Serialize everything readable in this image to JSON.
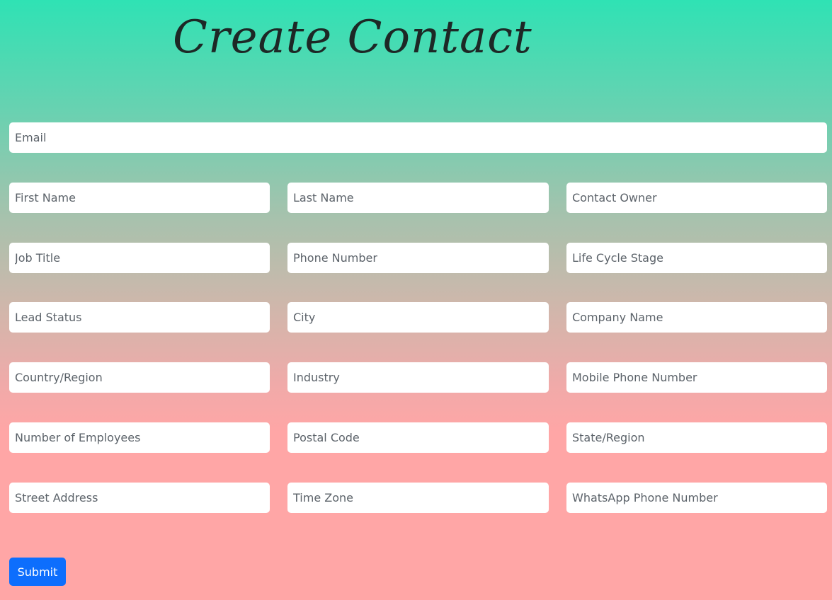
{
  "title": "Create Contact",
  "form": {
    "email": {
      "placeholder": "Email",
      "value": ""
    },
    "first_name": {
      "placeholder": "First Name",
      "value": ""
    },
    "last_name": {
      "placeholder": "Last Name",
      "value": ""
    },
    "contact_owner": {
      "placeholder": "Contact Owner",
      "value": ""
    },
    "job_title": {
      "placeholder": "Job Title",
      "value": ""
    },
    "phone_number": {
      "placeholder": "Phone Number",
      "value": ""
    },
    "life_cycle_stage": {
      "placeholder": "Life Cycle Stage",
      "value": ""
    },
    "lead_status": {
      "placeholder": "Lead Status",
      "value": ""
    },
    "city": {
      "placeholder": "City",
      "value": ""
    },
    "company_name": {
      "placeholder": "Company Name",
      "value": ""
    },
    "country_region": {
      "placeholder": "Country/Region",
      "value": ""
    },
    "industry": {
      "placeholder": "Industry",
      "value": ""
    },
    "mobile_phone_number": {
      "placeholder": "Mobile Phone Number",
      "value": ""
    },
    "number_of_employees": {
      "placeholder": "Number of Employees",
      "value": ""
    },
    "postal_code": {
      "placeholder": "Postal Code",
      "value": ""
    },
    "state_region": {
      "placeholder": "State/Region",
      "value": ""
    },
    "street_address": {
      "placeholder": "Street Address",
      "value": ""
    },
    "time_zone": {
      "placeholder": "Time Zone",
      "value": ""
    },
    "whatsapp_phone_number": {
      "placeholder": "WhatsApp Phone Number",
      "value": ""
    }
  },
  "submit_label": "Submit",
  "colors": {
    "gradient_top": "#2fe2b4",
    "gradient_bottom": "#ffa6a6",
    "submit_button": "#0d6efd"
  }
}
